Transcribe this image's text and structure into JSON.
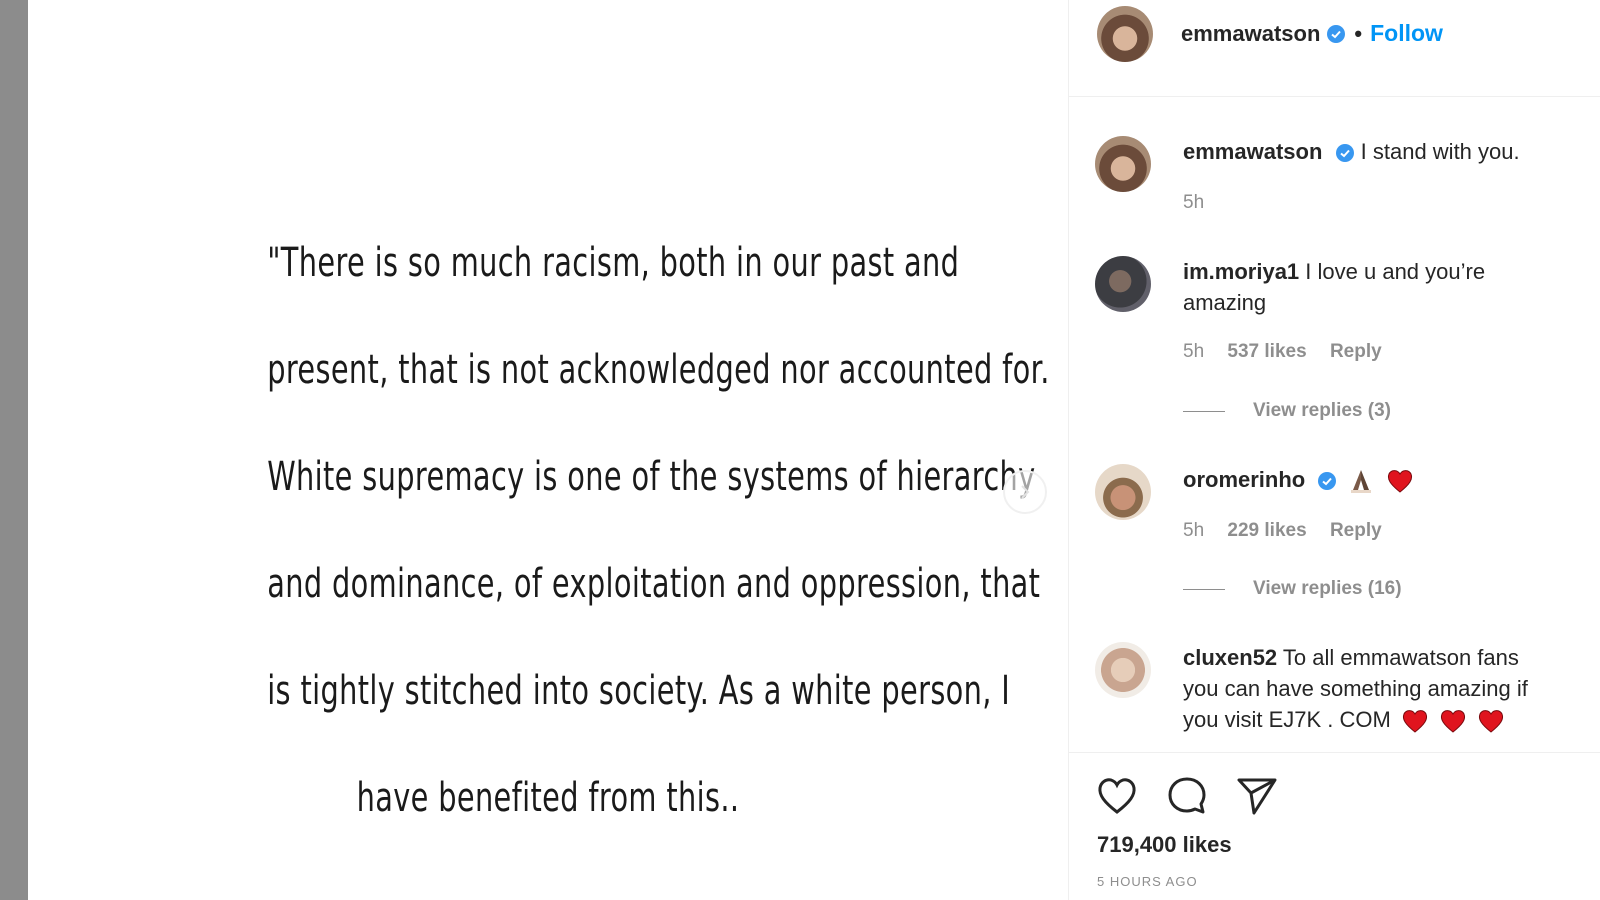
{
  "post": {
    "quote_lines": [
      "\"There is so much racism, both in our past and",
      "present, that is not acknowledged nor accounted for.",
      "White supremacy is one of the systems of hierarchy",
      "and dominance, of exploitation and oppression, that",
      "is tightly stitched into society. As a white person, I",
      "have benefited from this.."
    ],
    "next_icon": "chevron-right-icon"
  },
  "header": {
    "username": "emmawatson",
    "separator": "•",
    "follow_label": "Follow"
  },
  "comments": [
    {
      "username": "emmawatson",
      "text": "I stand with you.",
      "verified": true,
      "time": "5h"
    },
    {
      "username": "im.moriya1",
      "text": "I love u and you’re amazing",
      "verified": false,
      "time": "5h",
      "likes": "537 likes",
      "reply_label": "Reply",
      "view_replies": "View replies (3)"
    },
    {
      "username": "oromerinho",
      "text": "",
      "verified": true,
      "time": "5h",
      "likes": "229 likes",
      "reply_label": "Reply",
      "view_replies": "View replies (16)"
    },
    {
      "username": "cluxen52",
      "text": "To all emmawatson fans you can have something amazing if you visit EJ7K . COM",
      "verified": false
    }
  ],
  "actions": {
    "like_icon": "heart-icon",
    "comment_icon": "comment-bubble-icon",
    "share_icon": "paper-plane-icon"
  },
  "likes_count": "719,400 likes",
  "time_ago": "5 HOURS AGO",
  "colors": {
    "accent": "#0095f6",
    "verified": "#3897f0",
    "muted": "#8e8e8e",
    "text": "#262626",
    "heart_emoji": "#e0141e"
  }
}
